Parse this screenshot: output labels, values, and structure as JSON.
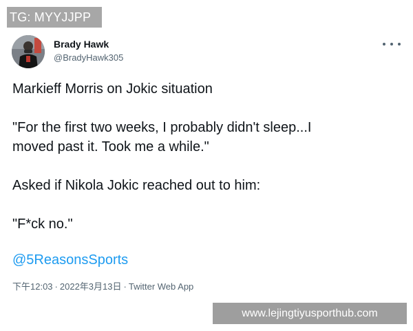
{
  "overlay": {
    "tag_text": "TG: MYYJJPP"
  },
  "tweet": {
    "author": {
      "display_name": "Brady Hawk",
      "handle": "@BradyHawk305"
    },
    "lines": [
      "Markieff Morris on Jokic situation",
      "",
      "\"For the first two weeks, I probably didn't sleep...I",
      "moved past it. Took me a while.\"",
      "",
      "Asked if Nikola Jokic reached out to him:",
      "",
      "\"F*ck no.\""
    ],
    "mention": "@5ReasonsSports",
    "meta": {
      "time": "下午12:03",
      "date": "2022年3月13日",
      "source": "Twitter Web App",
      "separator": "·"
    },
    "icons": {
      "more": "more-horizontal-icon"
    }
  },
  "watermark": {
    "text": "www.lejingtiyusporthub.com"
  },
  "colors": {
    "text": "#0f1419",
    "muted": "#536471",
    "link": "#1d9bf0",
    "overlay_bg": "#a7a7a7",
    "watermark_bg": "#9e9e9e"
  }
}
